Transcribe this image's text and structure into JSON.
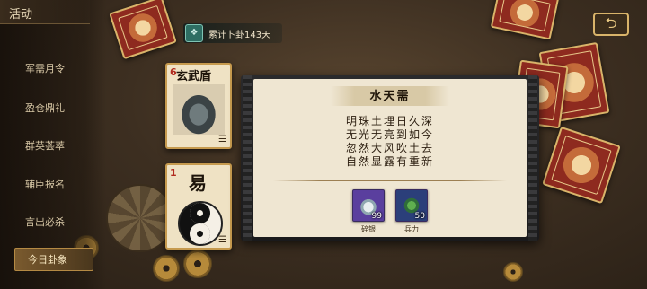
{
  "sidebar": {
    "title": "活动",
    "items": [
      {
        "label": "军需月令",
        "active": false
      },
      {
        "label": "盈仓鼎礼",
        "active": false
      },
      {
        "label": "群英荟萃",
        "active": false
      },
      {
        "label": "辅臣报名",
        "active": false
      },
      {
        "label": "言出必杀",
        "active": false
      },
      {
        "label": "今日卦象",
        "active": true
      }
    ]
  },
  "counter": {
    "icon": "divination-book-icon",
    "text": "累计卜卦143天"
  },
  "cards": [
    {
      "cost": "6",
      "name": "玄武盾",
      "art": "black-tortoise-statue"
    },
    {
      "cost": "1",
      "name": "易",
      "art": "yin-yang"
    }
  ],
  "panel": {
    "title": "水天需",
    "poem": [
      "明珠土埋日久深",
      "无光无亮到如今",
      "忽然大风吹土去",
      "自然显露有重新"
    ],
    "rewards": [
      {
        "label": "碎银",
        "qty": "99",
        "icon": "silver-ingot-icon",
        "color": "#5a3f9e"
      },
      {
        "label": "兵力",
        "qty": "50",
        "icon": "soldier-icon",
        "color": "#2b3f7a"
      }
    ]
  },
  "colors": {
    "accent_gold": "#c69a4e",
    "panel_paper": "#efe6d2",
    "card_red": "#8e2a1f"
  }
}
